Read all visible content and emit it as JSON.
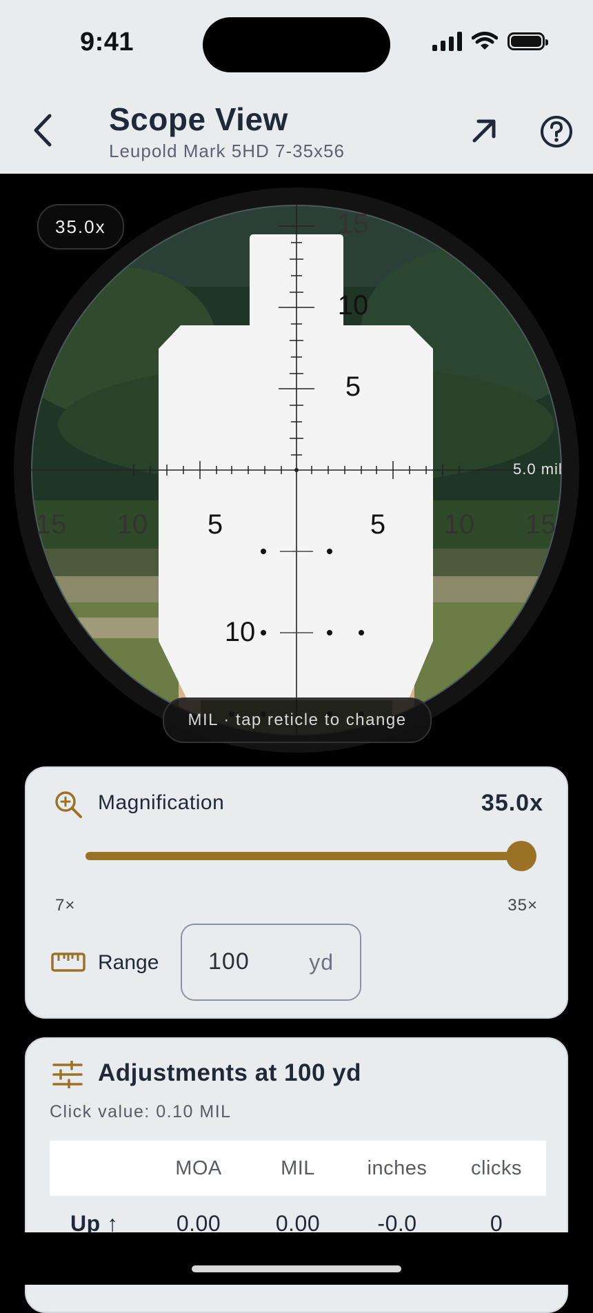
{
  "status_bar": {
    "time": "9:41"
  },
  "header": {
    "title": "Scope View",
    "subtitle": "Leupold Mark 5HD 7-35x56",
    "icons": {
      "back": "chevron-left-icon",
      "expand": "arrow-up-right-icon",
      "help": "question-circle-icon"
    }
  },
  "scope": {
    "magnification_badge": "35.0x",
    "mil_label": "5.0 mil",
    "hint": "MIL · tap reticle to change",
    "reticle_labels": {
      "up": [
        "15",
        "10",
        "5"
      ],
      "left": [
        "15",
        "10",
        "5"
      ],
      "right": [
        "5",
        "10",
        "15"
      ],
      "down": [
        "10"
      ]
    }
  },
  "magnification": {
    "label": "Magnification",
    "value": "35.0x",
    "min_label": "7×",
    "max_label": "35×",
    "min": 7,
    "max": 35,
    "current": 35,
    "accent_color": "#9a7125"
  },
  "range": {
    "label": "Range",
    "value": "100",
    "unit": "yd"
  },
  "adjustments": {
    "title": "Adjustments at 100 yd",
    "click_value": "Click value: 0.10 MIL",
    "columns": [
      "",
      "MOA",
      "MIL",
      "inches",
      "clicks"
    ],
    "rows": [
      {
        "label": "Up ↑",
        "moa": "0.00",
        "mil": "0.00",
        "inches": "-0.0",
        "clicks": "0"
      }
    ]
  }
}
